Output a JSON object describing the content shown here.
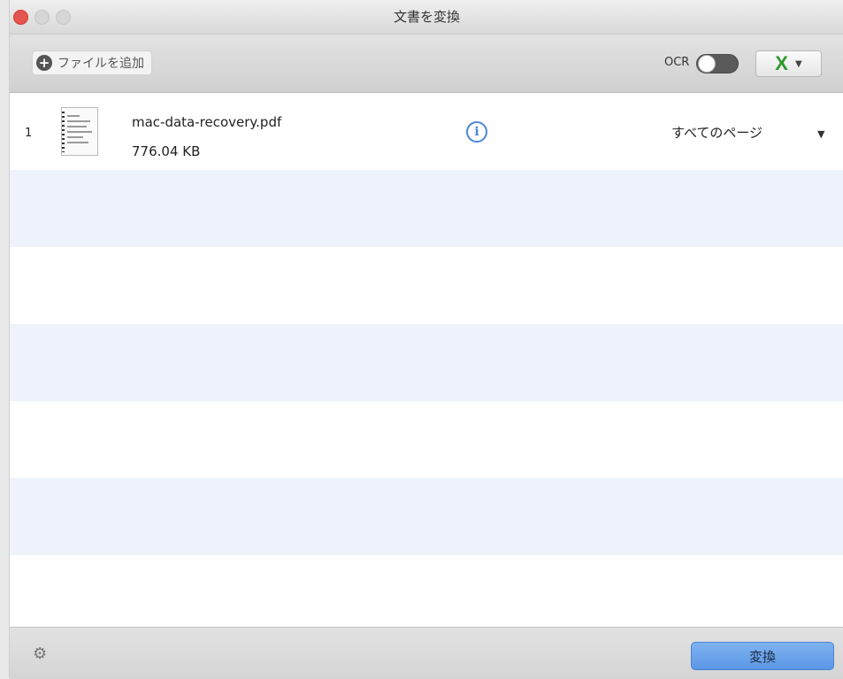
{
  "window": {
    "title": "文書を変換"
  },
  "toolbar": {
    "add_file_label": "ファイルを追加",
    "ocr_label": "OCR",
    "ocr_enabled": false,
    "format_icon": "excel-icon",
    "format_glyph": "X"
  },
  "files": [
    {
      "index": "1",
      "name": "mac-data-recovery.pdf",
      "size": "776.04 KB",
      "pages": "すべてのページ"
    }
  ],
  "footer": {
    "convert_label": "変換"
  },
  "colors": {
    "accent": "#5b97e6",
    "alt_row": "#eef3fb",
    "excel_green": "#2c9a2c",
    "close": "#e5554f"
  }
}
